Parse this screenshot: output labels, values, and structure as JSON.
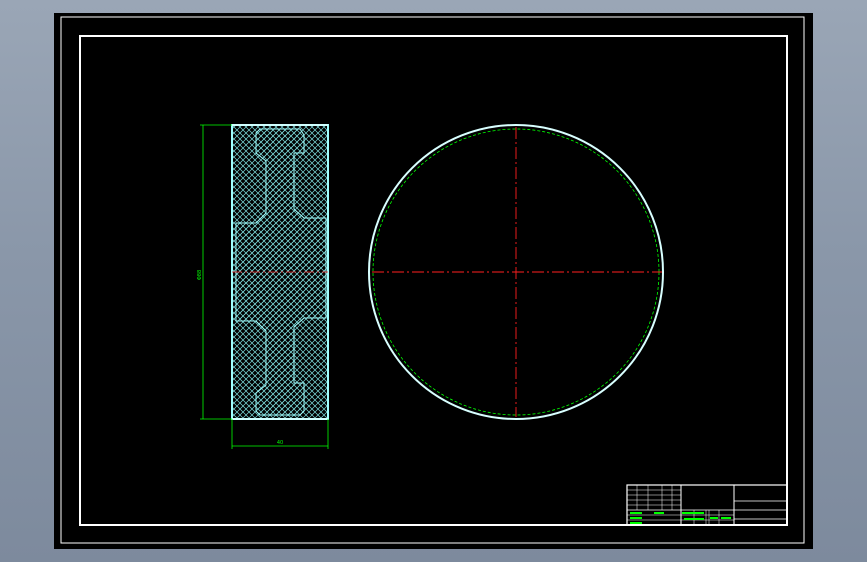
{
  "drawing": {
    "dim_height_text": "Φ88",
    "dim_width_text": "40"
  },
  "title_block": {
    "left_rows": [
      "",
      "",
      "",
      ""
    ],
    "green_labels": [
      "设计",
      "审核",
      "工艺"
    ],
    "right_cells": [
      "",
      "",
      ""
    ]
  },
  "colors": {
    "background": "#000000",
    "frame": "#ffffff",
    "section": "#a0ffff",
    "dimension": "#00ff00",
    "centerline": "#ff2020"
  }
}
